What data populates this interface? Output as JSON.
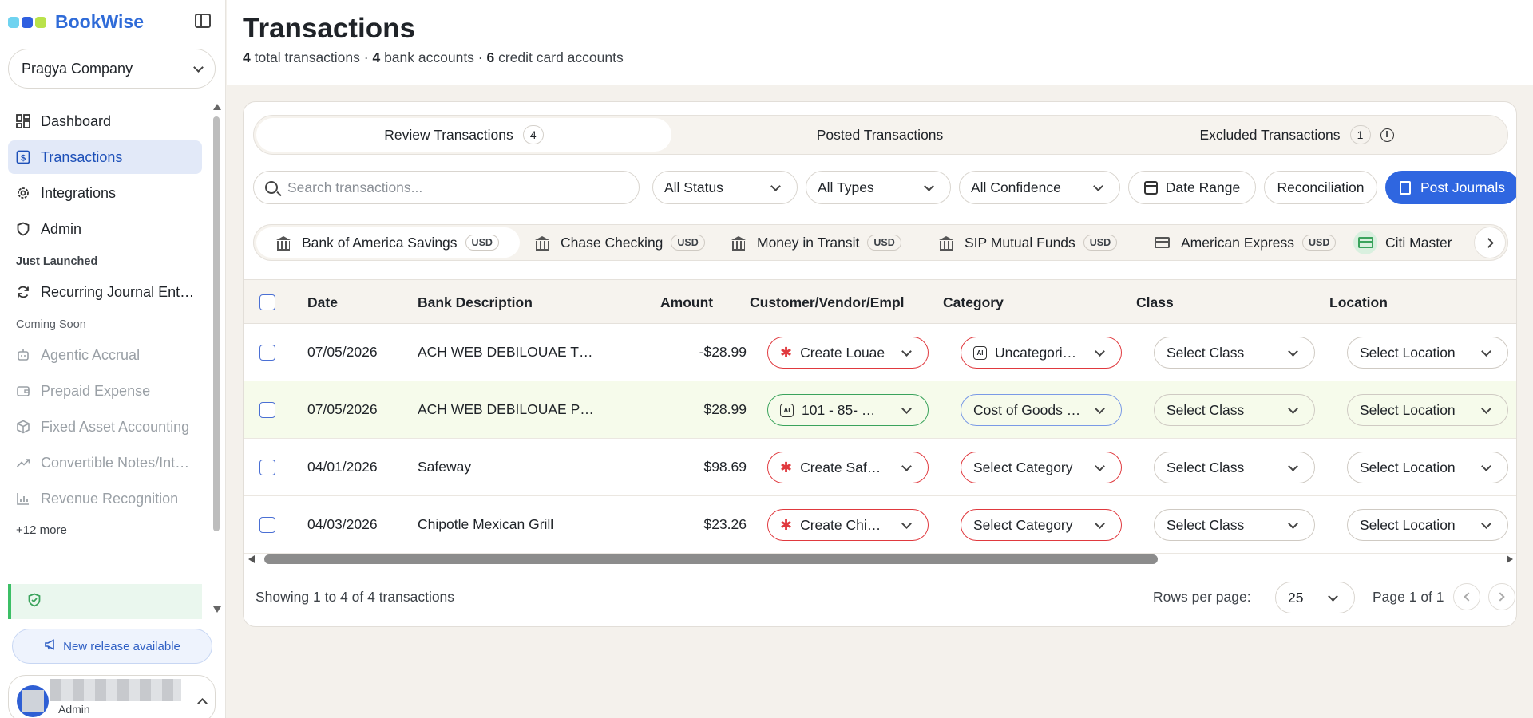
{
  "app": {
    "name": "BookWise"
  },
  "company": {
    "name": "Pragya Company"
  },
  "nav": {
    "main": [
      {
        "label": "Dashboard",
        "icon": "dashboard-icon"
      },
      {
        "label": "Transactions",
        "icon": "dollar-doc-icon",
        "active": true
      },
      {
        "label": "Integrations",
        "icon": "gear-icon"
      },
      {
        "label": "Admin",
        "icon": "shield-icon"
      }
    ],
    "just_launched_label": "Just Launched",
    "just_launched": [
      {
        "label": "Recurring Journal Ent…",
        "icon": "refresh-icon"
      }
    ],
    "coming_soon_label": "Coming Soon",
    "coming_soon": [
      {
        "label": "Agentic Accrual",
        "icon": "robot-icon"
      },
      {
        "label": "Prepaid Expense",
        "icon": "wallet-icon"
      },
      {
        "label": "Fixed Asset Accounting",
        "icon": "box-icon"
      },
      {
        "label": "Convertible Notes/Int…",
        "icon": "trend-icon"
      },
      {
        "label": "Revenue Recognition",
        "icon": "bar-chart-icon"
      }
    ],
    "more_label": "+12 more"
  },
  "release_label": "New release available",
  "user": {
    "role": "Admin"
  },
  "page": {
    "title": "Transactions",
    "counts": {
      "total": "4",
      "total_label": "total transactions",
      "bank": "4",
      "bank_label": "bank accounts",
      "credit": "6",
      "credit_label": "credit card accounts"
    }
  },
  "tabs": [
    {
      "label": "Review Transactions",
      "count": "4"
    },
    {
      "label": "Posted Transactions"
    },
    {
      "label": "Excluded Transactions",
      "count": "1"
    }
  ],
  "toolbar": {
    "search_placeholder": "Search transactions...",
    "status": "All Status",
    "types": "All Types",
    "confidence": "All Confidence",
    "date_range": "Date Range",
    "reconciliation": "Reconciliation",
    "post_journals": "Post Journals"
  },
  "accounts": [
    {
      "name": "Bank of America Savings",
      "currency": "USD"
    },
    {
      "name": "Chase Checking",
      "currency": "USD"
    },
    {
      "name": "Money in Transit",
      "currency": "USD"
    },
    {
      "name": "SIP Mutual Funds",
      "currency": "USD"
    },
    {
      "name": "American Express",
      "currency": "USD"
    },
    {
      "name": "Citi Master"
    }
  ],
  "table": {
    "headers": {
      "date": "Date",
      "desc": "Bank Description",
      "amount": "Amount",
      "cve": "Customer/Vendor/Empl",
      "category": "Category",
      "class": "Class",
      "location": "Location"
    },
    "rows": [
      {
        "date": "07/05/2026",
        "desc": "ACH WEB DEBILOUAE T…",
        "amount": "-$28.99",
        "cve": "Create Louae",
        "category": "Uncategori…",
        "class": "Select Class",
        "location": "Select Location"
      },
      {
        "date": "07/05/2026",
        "desc": "ACH WEB DEBILOUAE P…",
        "amount": "$28.99",
        "cve": "101 - 85- …",
        "category": "Cost of Goods …",
        "class": "Select Class",
        "location": "Select Location"
      },
      {
        "date": "04/01/2026",
        "desc": "Safeway",
        "amount": "$98.69",
        "cve": "Create Saf…",
        "category": "Select Category",
        "class": "Select Class",
        "location": "Select Location"
      },
      {
        "date": "04/03/2026",
        "desc": "Chipotle Mexican Grill",
        "amount": "$23.26",
        "cve": "Create Chi…",
        "category": "Select Category",
        "class": "Select Class",
        "location": "Select Location"
      }
    ]
  },
  "footer": {
    "showing": "Showing 1 to 4 of 4 transactions",
    "rows_per_page_label": "Rows per page:",
    "rows_per_page": "25",
    "page_label": "Page 1 of 1"
  },
  "colors": {
    "accent": "#2f66e0",
    "brand": "#2f6bd8",
    "error": "#e0393e",
    "success": "#3aa35c"
  }
}
